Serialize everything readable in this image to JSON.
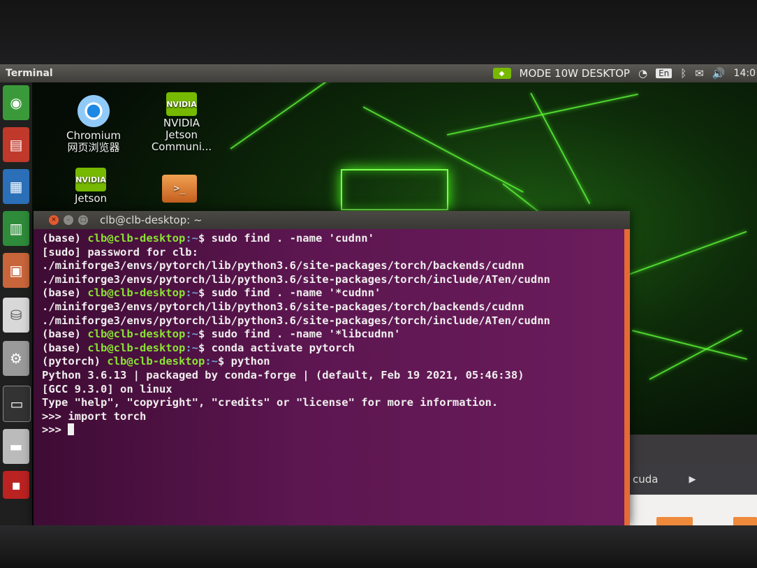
{
  "panel": {
    "app_title": "Terminal",
    "power_mode": "MODE 10W DESKTOP",
    "input_method": "En",
    "clock": "14:0"
  },
  "desktop_icons": [
    {
      "label_line1": "Chromium",
      "label_line2": "网页浏览器"
    },
    {
      "label_line1": "NVIDIA",
      "label_line2": "Jetson",
      "label_line3": "Communi..."
    },
    {
      "label_line1": "Jetson"
    },
    {
      "label_line1": ""
    }
  ],
  "terminal": {
    "title": "clb@clb-desktop: ~",
    "user_host": "clb@clb-desktop",
    "lines": [
      {
        "type": "prompt",
        "env": "(base) ",
        "path": ":~",
        "cmd": "$ sudo find . -name 'cudnn'"
      },
      {
        "type": "out",
        "text": "[sudo] password for clb:"
      },
      {
        "type": "out",
        "text": "./miniforge3/envs/pytorch/lib/python3.6/site-packages/torch/backends/cudnn"
      },
      {
        "type": "out",
        "text": "./miniforge3/envs/pytorch/lib/python3.6/site-packages/torch/include/ATen/cudnn"
      },
      {
        "type": "prompt",
        "env": "(base) ",
        "path": ":~",
        "cmd": "$ sudo find . -name '*cudnn'"
      },
      {
        "type": "out",
        "text": "./miniforge3/envs/pytorch/lib/python3.6/site-packages/torch/backends/cudnn"
      },
      {
        "type": "out",
        "text": "./miniforge3/envs/pytorch/lib/python3.6/site-packages/torch/include/ATen/cudnn"
      },
      {
        "type": "prompt",
        "env": "(base) ",
        "path": ":~",
        "cmd": "$ sudo find . -name '*libcudnn'"
      },
      {
        "type": "prompt",
        "env": "(base) ",
        "path": ":~",
        "cmd": "$ conda activate pytorch"
      },
      {
        "type": "prompt",
        "env": "(pytorch) ",
        "path": ":~",
        "cmd": "$ python"
      },
      {
        "type": "out",
        "text": "Python 3.6.13 | packaged by conda-forge | (default, Feb 19 2021, 05:46:38)"
      },
      {
        "type": "out",
        "text": "[GCC 9.3.0] on linux"
      },
      {
        "type": "out",
        "text": "Type \"help\", \"copyright\", \"credits\" or \"license\" for more information."
      },
      {
        "type": "out",
        "text": ">>> import torch"
      },
      {
        "type": "out",
        "text": ">>> "
      }
    ]
  },
  "file_manager": {
    "breadcrumb": "cuda"
  },
  "colors": {
    "accent_orange": "#e56b35",
    "prompt_green": "#8ae234",
    "prompt_blue": "#729fcf",
    "nvidia_green": "#76b900"
  }
}
